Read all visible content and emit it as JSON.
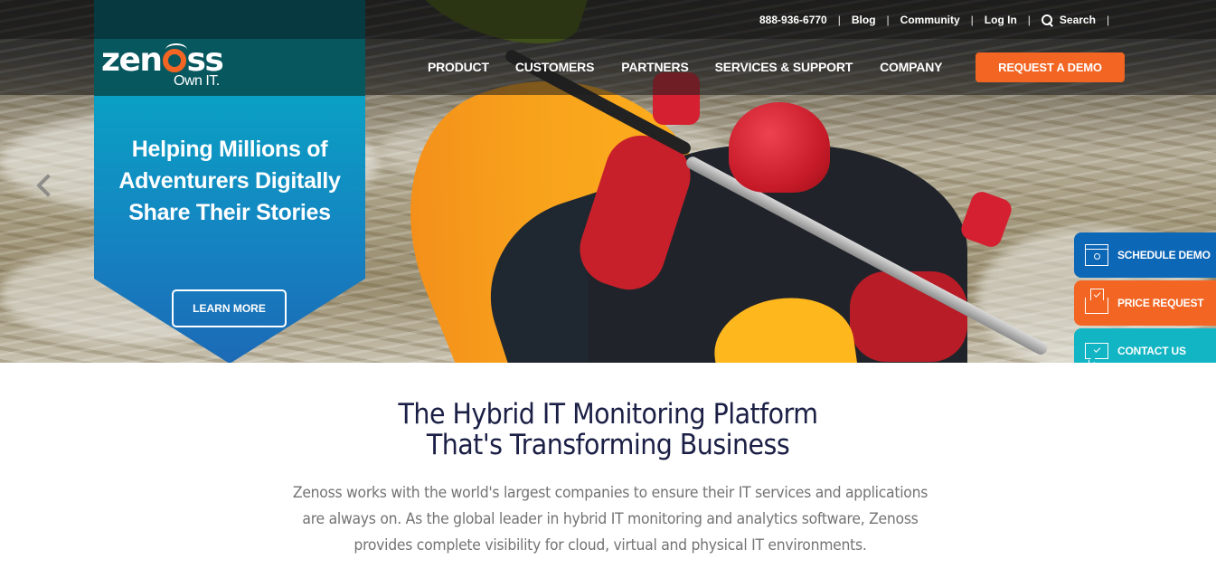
{
  "brand": {
    "logo_text": "zenoss",
    "tagline": "Own IT.",
    "colors": {
      "orange": "#f26522",
      "teal_dark": "#07575f",
      "banner_blue": "#1583c1",
      "schedule_blue": "#0d67b7",
      "contact_teal": "#12b5c3",
      "headline_navy": "#1b1f45"
    }
  },
  "utility_nav": {
    "phone": "888-936-6770",
    "blog": "Blog",
    "community": "Community",
    "login": "Log In",
    "search": "Search",
    "separator": "|"
  },
  "main_nav": {
    "items": [
      "PRODUCT",
      "CUSTOMERS",
      "PARTNERS",
      "SERVICES & SUPPORT",
      "COMPANY"
    ],
    "cta": "REQUEST A DEMO"
  },
  "hero": {
    "headline": "Helping Millions of Adventurers Digitally Share Their Stories",
    "cta": "LEARN MORE",
    "prev_icon": "chevron-left-icon"
  },
  "side_actions": [
    {
      "label": "SCHEDULE DEMO",
      "icon": "browser-search-icon"
    },
    {
      "label": "PRICE REQUEST",
      "icon": "envelope-check-icon"
    },
    {
      "label": "CONTACT US",
      "icon": "chat-check-icon"
    }
  ],
  "intro": {
    "title_line1": "The Hybrid IT Monitoring Platform",
    "title_line2": "That's Transforming Business",
    "body": "Zenoss works with the world's largest companies to ensure their IT services and applications are always on. As the global leader in hybrid IT monitoring and analytics software, Zenoss provides complete visibility for cloud, virtual and physical IT environments."
  }
}
